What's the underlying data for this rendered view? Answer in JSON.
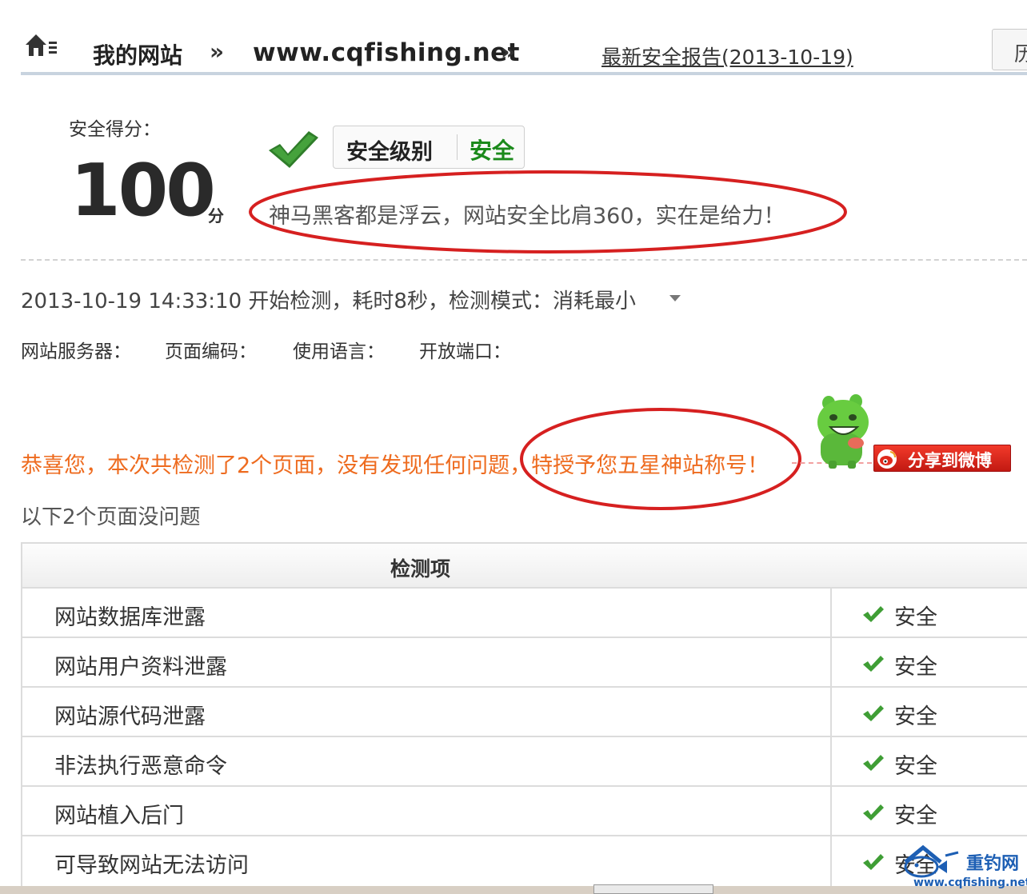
{
  "header": {
    "my_site": "我的网站",
    "separator": "»",
    "domain": "www.cqfishing.net",
    "report_link": "最新安全报告(2013-10-19)",
    "history_button": "历史",
    "home_icon": "home-icon"
  },
  "score": {
    "label": "安全得分：",
    "value": "100",
    "unit": "分",
    "level_label": "安全级别",
    "level_value": "安全",
    "slogan": "神马黑客都是浮云，网站安全比肩360，实在是给力！",
    "colors": {
      "safe_green": "#1b8a1b",
      "annotation_red": "#d62020"
    }
  },
  "scan": {
    "summary": "2013-10-19 14:33:10 开始检测，耗时8秒，检测模式：消耗最小",
    "server_label": "网站服务器：",
    "encoding_label": "页面编码：",
    "language_label": "使用语言：",
    "ports_label": "开放端口："
  },
  "result": {
    "congrats": "恭喜您，本次共检测了2个页面，没有发现任何问题，特授予您五星神站称号！",
    "share_button": "分享到微博",
    "no_issue_pages": "以下2个页面没问题",
    "colors": {
      "congrats_orange": "#ee6b1f",
      "weibo_red": "#e02a1c"
    }
  },
  "table": {
    "header": "检测项",
    "rows": [
      {
        "name": "网站数据库泄露",
        "status": "安全"
      },
      {
        "name": "网站用户资料泄露",
        "status": "安全"
      },
      {
        "name": "网站源代码泄露",
        "status": "安全"
      },
      {
        "name": "非法执行恶意命令",
        "status": "安全"
      },
      {
        "name": "网站植入后门",
        "status": "安全"
      },
      {
        "name": "可导致网站无法访问",
        "status": "安全"
      }
    ]
  },
  "watermark": {
    "name": "重钓网",
    "url": "www.cqfishing.net"
  }
}
